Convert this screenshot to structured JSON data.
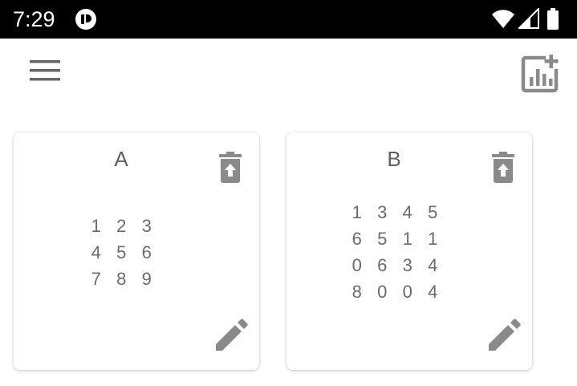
{
  "status_bar": {
    "time": "7:29",
    "icons": [
      "app-notification-icon",
      "wifi-icon",
      "cell-signal-icon",
      "battery-icon"
    ]
  },
  "app_bar": {
    "menu_icon": "hamburger-menu-icon",
    "action_icon": "add-chart-icon"
  },
  "colors": {
    "status_bar_bg": "#000000",
    "icon_gray": "#8a8a8a",
    "text_gray": "#5f5f5f"
  },
  "matrices": [
    {
      "name": "A",
      "rows": [
        [
          "1",
          "2",
          "3"
        ],
        [
          "4",
          "5",
          "6"
        ],
        [
          "7",
          "8",
          "9"
        ]
      ]
    },
    {
      "name": "B",
      "rows": [
        [
          "1",
          "3",
          "4",
          "5"
        ],
        [
          "6",
          "5",
          "1",
          "1"
        ],
        [
          "0",
          "6",
          "3",
          "4"
        ],
        [
          "8",
          "0",
          "0",
          "4"
        ]
      ]
    }
  ]
}
